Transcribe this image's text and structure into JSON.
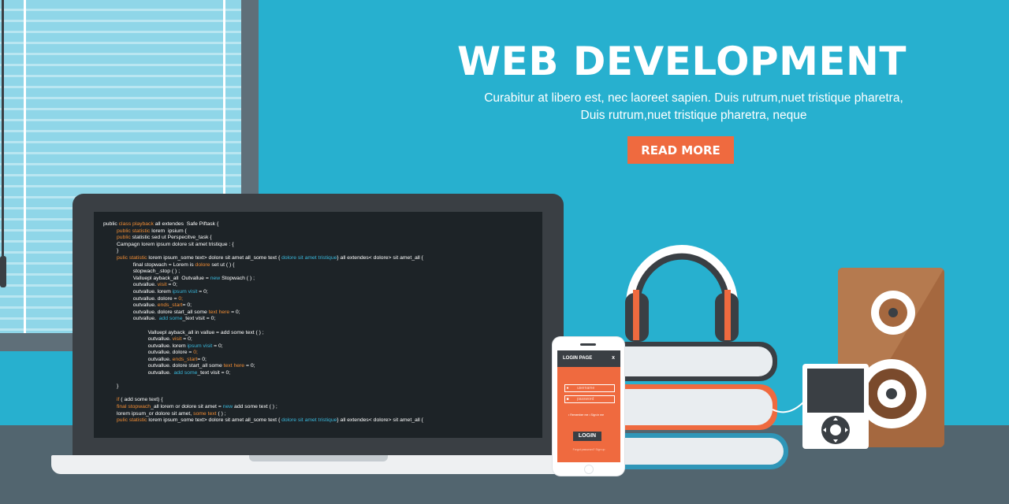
{
  "hero": {
    "title": "WEB DEVELOPMENT",
    "subtitle_line1": "Curabitur at libero est, nec laoreet sapien. Duis rutrum,nuet tristique pharetra,",
    "subtitle_line2": "Duis rutrum,nuet tristique pharetra, neque",
    "button_label": "READ MORE"
  },
  "code_lines": [
    [
      {
        "t": "public "
      },
      {
        "t": "class playback ",
        "c": "o"
      },
      {
        "t": "all extendes  Safe Piftask {"
      }
    ],
    [
      {
        "t": "         "
      },
      {
        "t": "public statistic ",
        "c": "o"
      },
      {
        "t": "lorem  ipsium {"
      }
    ],
    [
      {
        "t": "         "
      },
      {
        "t": "public ",
        "c": "o"
      },
      {
        "t": "statistic sed ut Perspecitve_task {"
      }
    ],
    [
      {
        "t": "         Campagn lorem ipsum dolore sit amet tristique : {"
      }
    ],
    [
      {
        "t": "         }"
      }
    ],
    [
      {
        "t": "         "
      },
      {
        "t": "pulic statistic ",
        "c": "o"
      },
      {
        "t": "lorem ipsum_some text> dolore sit amet all_some text { "
      },
      {
        "t": "dolore sit amet tristique",
        "c": "c"
      },
      {
        "t": "} all extendes< dolore> sit amet_all {"
      }
    ],
    [
      {
        "t": "                    final stopwach = Lorem is "
      },
      {
        "t": "dolore ",
        "c": "o"
      },
      {
        "t": "set ut ( ) {"
      }
    ],
    [
      {
        "t": "                    stopwach_.stop ( ) ;"
      }
    ],
    [
      {
        "t": "                    Valluepl ayback_all  Outvallue = "
      },
      {
        "t": "new ",
        "c": "c"
      },
      {
        "t": "Stopwach ( ) ;"
      }
    ],
    [
      {
        "t": "                    outvallue. "
      },
      {
        "t": "visit ",
        "c": "o"
      },
      {
        "t": "= 0;"
      }
    ],
    [
      {
        "t": "                    outvallue. lorem "
      },
      {
        "t": "ipsum visit ",
        "c": "c"
      },
      {
        "t": "= 0;"
      }
    ],
    [
      {
        "t": "                    outvallue. dolore = "
      },
      {
        "t": "0;",
        "c": "o"
      }
    ],
    [
      {
        "t": "                    outvallue. "
      },
      {
        "t": "ends_start",
        "c": "o"
      },
      {
        "t": "= 0;"
      }
    ],
    [
      {
        "t": "                    outvallue. dolore start_all some "
      },
      {
        "t": "text here ",
        "c": "o"
      },
      {
        "t": "= 0;"
      }
    ],
    [
      {
        "t": "                    outvallue.  "
      },
      {
        "t": "add some",
        "c": "c"
      },
      {
        "t": "_text visit = 0;"
      }
    ],
    [
      {
        "t": ""
      }
    ],
    [
      {
        "t": "                              Valluepl ayback_all in vallue = add some text ( ) ;"
      }
    ],
    [
      {
        "t": "                              outvallue. "
      },
      {
        "t": "visit ",
        "c": "o"
      },
      {
        "t": "= 0;"
      }
    ],
    [
      {
        "t": "                              outvallue. lorem "
      },
      {
        "t": "ipsum visit ",
        "c": "c"
      },
      {
        "t": "= 0;"
      }
    ],
    [
      {
        "t": "                              outvallue. dolore = "
      },
      {
        "t": "0;",
        "c": "o"
      }
    ],
    [
      {
        "t": "                              outvallue. "
      },
      {
        "t": "ends_start",
        "c": "o"
      },
      {
        "t": "= 0;"
      }
    ],
    [
      {
        "t": "                              outvallue. dolore start_all some "
      },
      {
        "t": "text here ",
        "c": "o"
      },
      {
        "t": "= 0;"
      }
    ],
    [
      {
        "t": "                              outvallue.  "
      },
      {
        "t": "add some",
        "c": "c"
      },
      {
        "t": "_text visit = 0;"
      }
    ],
    [
      {
        "t": ""
      }
    ],
    [
      {
        "t": "         }"
      }
    ],
    [
      {
        "t": ""
      }
    ],
    [
      {
        "t": "         "
      },
      {
        "t": "if ",
        "c": "o"
      },
      {
        "t": "( add some text) {"
      }
    ],
    [
      {
        "t": "         "
      },
      {
        "t": "final stopwach",
        "c": "o"
      },
      {
        "t": "_all lorem or dolore sit amet = "
      },
      {
        "t": "new ",
        "c": "c"
      },
      {
        "t": "add some text ( ) ;"
      }
    ],
    [
      {
        "t": "         lorem ipsum_or dolore sit amet, "
      },
      {
        "t": "some text ",
        "c": "o"
      },
      {
        "t": "( ) ;"
      }
    ],
    [
      {
        "t": "         "
      },
      {
        "t": "pulic statistic ",
        "c": "o"
      },
      {
        "t": "lorem ipsum_some text> dolore sit amet all_some text { "
      },
      {
        "t": "dolore sit amet tristique",
        "c": "c"
      },
      {
        "t": "} all extendes< dolore> sit amet_all {"
      }
    ]
  ],
  "phone": {
    "header_title": "LOGIN PAGE",
    "close_label": "x",
    "username_placeholder": "username",
    "password_placeholder": "password",
    "remember_text": "• Remember me   • Sign in me",
    "login_label": "LOGIN",
    "forgot_text": "Forgot password? Sign up"
  },
  "icons": {
    "user": "user-icon",
    "lock": "lock-icon",
    "close": "close-icon"
  },
  "colors": {
    "background": "#27b0cf",
    "accent": "#ef6a3f",
    "dark": "#3a3f44",
    "floor": "#52656f",
    "speaker": "#a5683f"
  }
}
